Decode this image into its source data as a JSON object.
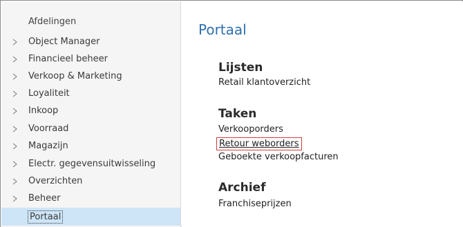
{
  "sidebar": {
    "heading": "Afdelingen",
    "items": [
      {
        "label": "Object Manager",
        "icon": "chevron-right-icon"
      },
      {
        "label": "Financieel beheer",
        "icon": "chevron-right-icon"
      },
      {
        "label": "Verkoop & Marketing",
        "icon": "chevron-right-icon"
      },
      {
        "label": "Loyaliteit",
        "icon": "chevron-right-icon"
      },
      {
        "label": "Inkoop",
        "icon": "chevron-right-icon"
      },
      {
        "label": "Voorraad",
        "icon": "chevron-right-icon"
      },
      {
        "label": "Magazijn",
        "icon": "chevron-right-icon"
      },
      {
        "label": "Electr. gegevensuitwisseling",
        "icon": "chevron-right-icon"
      },
      {
        "label": "Overzichten",
        "icon": "chevron-right-icon"
      },
      {
        "label": "Beheer",
        "icon": "chevron-right-icon"
      },
      {
        "label": "Portaal",
        "selected": true
      }
    ]
  },
  "main": {
    "title": "Portaal",
    "sections": [
      {
        "title": "Lijsten",
        "links": [
          "Retail klantoverzicht"
        ]
      },
      {
        "title": "Taken",
        "links": [
          "Verkooporders",
          "Retour weborders",
          "Geboekte verkoopfacturen"
        ]
      },
      {
        "title": "Archief",
        "links": [
          "Franchiseprijzen"
        ]
      }
    ]
  },
  "colors": {
    "accent": "#2e6fae",
    "selected_bg": "#cde5f7",
    "highlight_border": "#d23b3b"
  }
}
